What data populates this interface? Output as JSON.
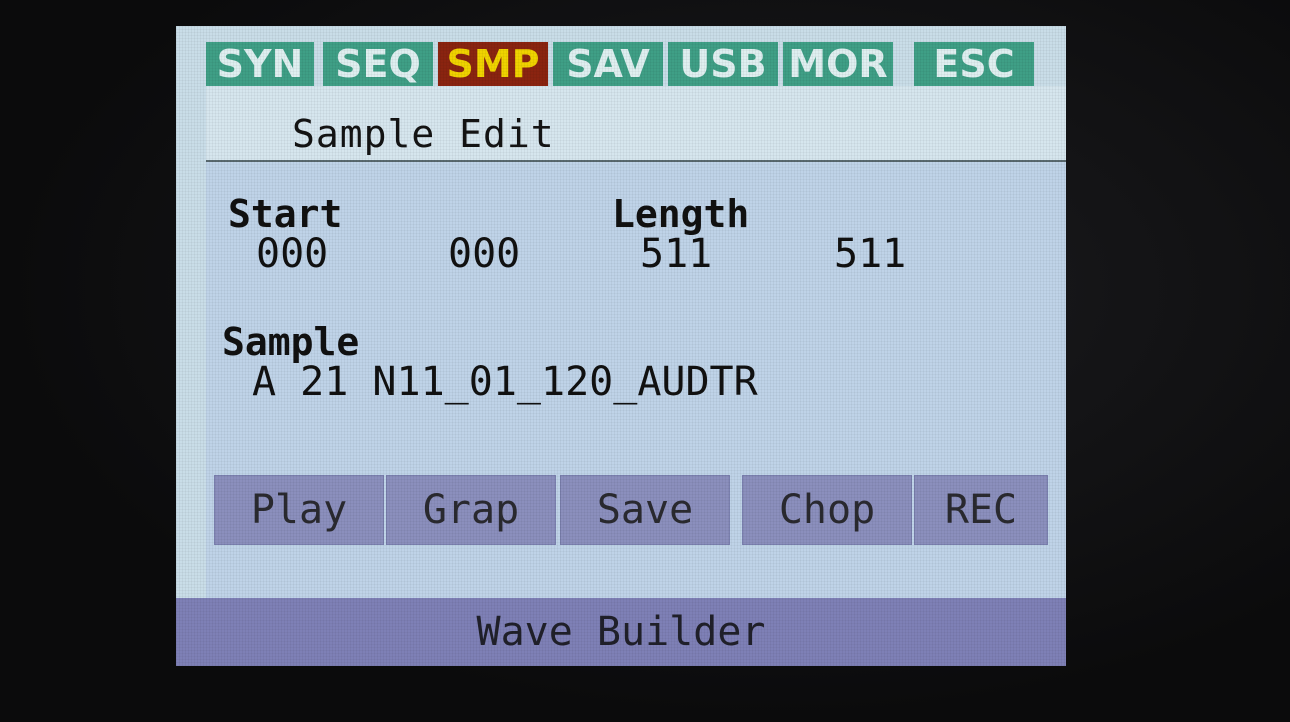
{
  "tabs": [
    {
      "label": "SYN",
      "bg": "#3f9f86",
      "active": false
    },
    {
      "label": "SEQ",
      "bg": "#3f9f86",
      "active": false
    },
    {
      "label": "SMP",
      "bg": "#8a2410",
      "active": true
    },
    {
      "label": "SAV",
      "bg": "#3f9f86",
      "active": false
    },
    {
      "label": "USB",
      "bg": "#3f9f86",
      "active": false
    },
    {
      "label": "MOR",
      "bg": "#3f9f86",
      "active": false
    },
    {
      "label": "ESC",
      "bg": "#3f9f86",
      "active": false
    }
  ],
  "page": {
    "title": "Sample Edit"
  },
  "params": {
    "start_label": "Start",
    "start_value_1": "000",
    "start_value_2": "000",
    "length_label": "Length",
    "length_value_1": "511",
    "length_value_2": "511",
    "sample_label": "Sample",
    "sample_value": "A 21 N11_01_120_AUDTR"
  },
  "buttons": [
    {
      "label": "Play"
    },
    {
      "label": "Grap"
    },
    {
      "label": "Save"
    },
    {
      "label": "Chop"
    },
    {
      "label": "REC"
    }
  ],
  "footer": {
    "label": "Wave Builder"
  },
  "colors": {
    "screen_bg": "#c9dde8",
    "button_bg": "#8b8fbd",
    "footer_bg": "#7e80b6"
  }
}
